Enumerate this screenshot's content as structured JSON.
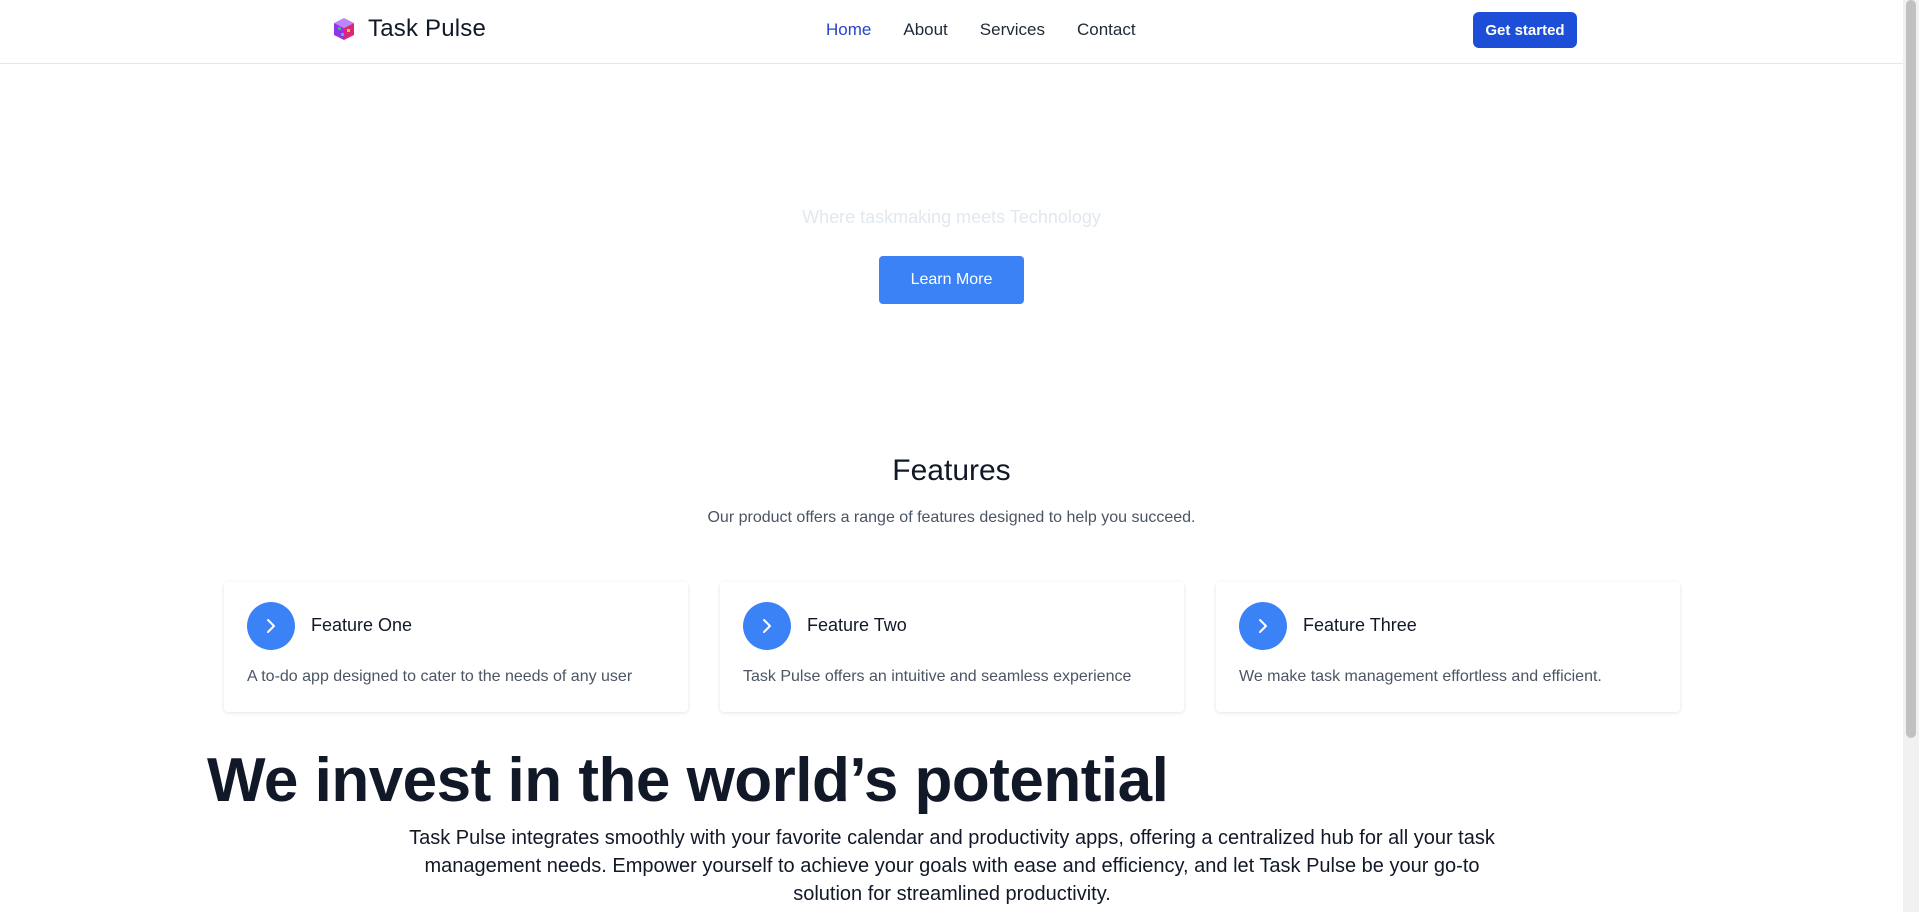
{
  "header": {
    "brand_name": "Task Pulse",
    "nav": [
      "Home",
      "About",
      "Services",
      "Contact"
    ],
    "active_nav": "Home",
    "cta_label": "Get started"
  },
  "hero": {
    "tagline": "Where taskmaking meets Technology",
    "button_label": "Learn More"
  },
  "features": {
    "title": "Features",
    "subtitle": "Our product offers a range of features designed to help you succeed.",
    "items": [
      {
        "title": "Feature One",
        "description": "A to-do app designed to cater to the needs of any user",
        "icon": "chevron-right-icon"
      },
      {
        "title": "Feature Two",
        "description": "Task Pulse offers an intuitive and seamless experience",
        "icon": "chevron-right-icon"
      },
      {
        "title": "Feature Three",
        "description": "We make task management effortless and efficient.",
        "icon": "chevron-right-icon"
      }
    ]
  },
  "invest": {
    "title": "We invest in the world’s potential",
    "body": "Task Pulse integrates smoothly with your favorite calendar and productivity apps, offering a centralized hub for all your task management needs. Empower yourself to achieve your goals with ease and efficiency, and let Task Pulse be your go-to solution for streamlined productivity."
  },
  "colors": {
    "accent": "#3b82f6",
    "cta": "#1d4ed8",
    "active_nav": "#2743c9",
    "tagline": "#e2e8f0"
  }
}
